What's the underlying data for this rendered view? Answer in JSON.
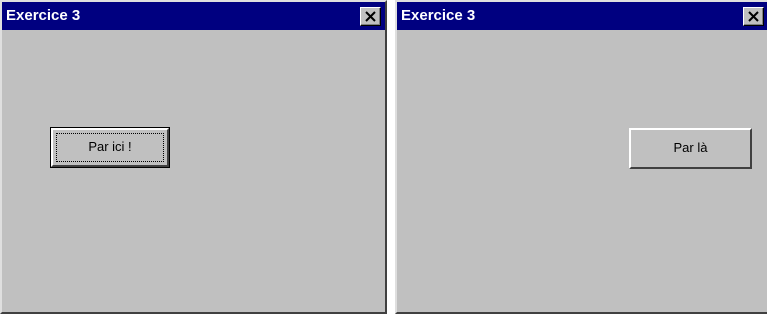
{
  "windows": [
    {
      "title": "Exercice 3",
      "button_label": "Par ici !",
      "button_state": "focused"
    },
    {
      "title": "Exercice 3",
      "button_label": "Par là",
      "button_state": "normal"
    }
  ],
  "colors": {
    "titlebar": "#000080",
    "face": "#c0c0c0",
    "title_text": "#ffffff"
  },
  "icons": {
    "close": "close-icon"
  }
}
